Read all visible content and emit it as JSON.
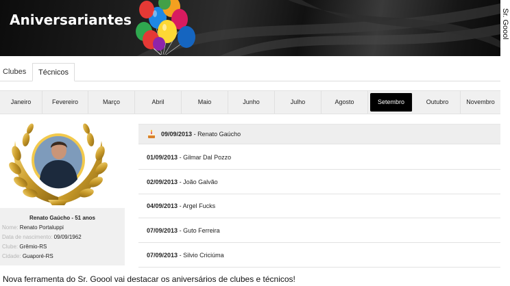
{
  "brand": "Sr. Goool",
  "banner": {
    "title": "Aniversariantes"
  },
  "tabs": [
    {
      "label": "Clubes",
      "active": false
    },
    {
      "label": "Técnicos",
      "active": true
    }
  ],
  "months": [
    "Janeiro",
    "Fevereiro",
    "Março",
    "Abril",
    "Maio",
    "Junho",
    "Julho",
    "Agosto",
    "Setembro",
    "Outubro",
    "Novembro"
  ],
  "selected_month": "Setembro",
  "profile": {
    "title": "Renato Gaúcho - 51 anos",
    "rows": [
      {
        "label": "Nome:",
        "value": "Renato Portaluppi"
      },
      {
        "label": "Data de nascimento:",
        "value": "09/09/1962"
      },
      {
        "label": "Clube:",
        "value": "Grêmio-RS"
      },
      {
        "label": "Cidade:",
        "value": "Guaporé-RS"
      }
    ]
  },
  "birthdays": [
    {
      "date": "09/09/2013",
      "name": "Renato Gaúcho",
      "highlight": true
    },
    {
      "date": "01/09/2013",
      "name": "Gilmar Dal Pozzo",
      "highlight": false
    },
    {
      "date": "02/09/2013",
      "name": "João Galvão",
      "highlight": false
    },
    {
      "date": "04/09/2013",
      "name": "Argel Fucks",
      "highlight": false
    },
    {
      "date": "07/09/2013",
      "name": "Guto Ferreira",
      "highlight": false
    },
    {
      "date": "07/09/2013",
      "name": "Silvio Criciúma",
      "highlight": false
    }
  ],
  "caption": "Nova ferramenta do Sr. Goool vai destacar os aniversários de clubes e técnicos!",
  "colors": {
    "selected_month_bg": "#000000",
    "banner_bg": "#1a1a1a",
    "highlight_row_bg": "#eeeeee"
  },
  "icons": {
    "cake": "birthday-cake-icon",
    "balloons": "balloons-icon",
    "wreath": "laurel-wreath-icon"
  }
}
